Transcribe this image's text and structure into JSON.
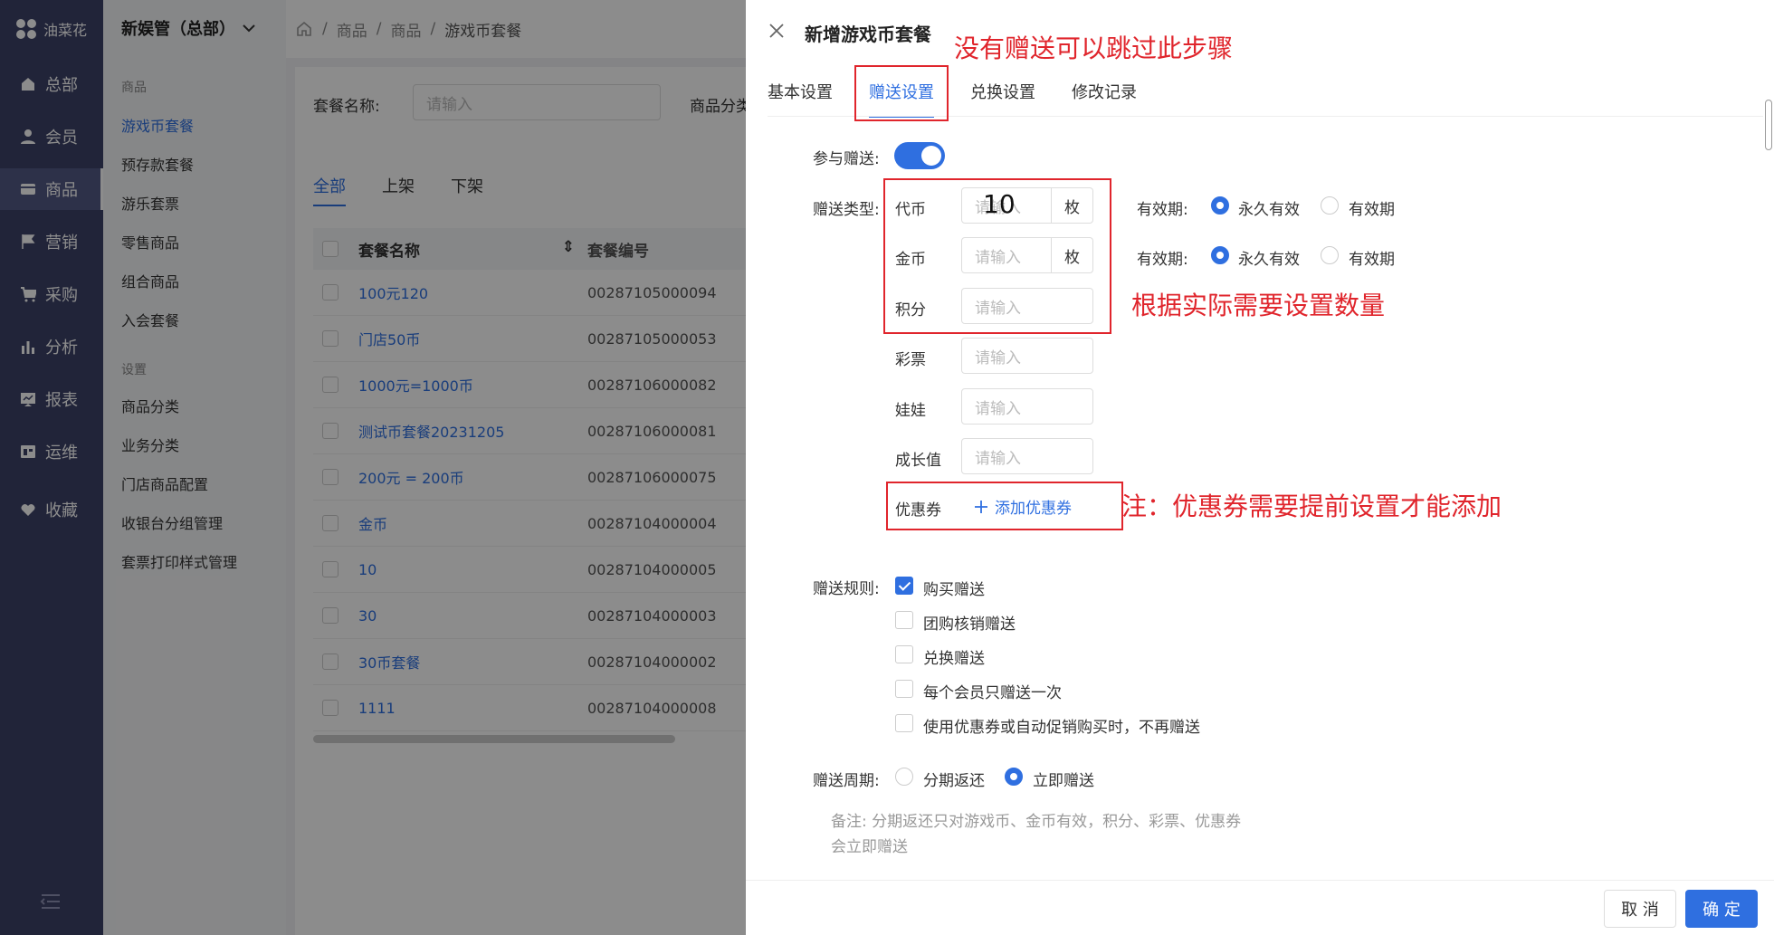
{
  "nav": {
    "brand": "油菜花",
    "items": [
      {
        "label": "总部",
        "icon": "home-icon"
      },
      {
        "label": "会员",
        "icon": "user-icon"
      },
      {
        "label": "商品",
        "icon": "card-icon"
      },
      {
        "label": "营销",
        "icon": "flag-icon"
      },
      {
        "label": "采购",
        "icon": "cart-icon"
      },
      {
        "label": "分析",
        "icon": "bar-chart-icon"
      },
      {
        "label": "报表",
        "icon": "report-icon"
      },
      {
        "label": "运维",
        "icon": "tools-icon"
      },
      {
        "label": "收藏",
        "icon": "heart-icon"
      }
    ],
    "active_index": 2
  },
  "submenu": {
    "title": "新娱管（总部）",
    "group1": "商品",
    "items1": [
      "游戏币套餐",
      "预存款套餐",
      "游乐套票",
      "零售商品",
      "组合商品",
      "入会套餐"
    ],
    "group2": "设置",
    "items2": [
      "商品分类",
      "业务分类",
      "门店商品配置",
      "收银台分组管理",
      "套票打印样式管理"
    ],
    "active_item": "游戏币套餐"
  },
  "breadcrumb": [
    "商品",
    "商品",
    "游戏币套餐"
  ],
  "filter": {
    "name_label": "套餐名称:",
    "name_placeholder": "请输入",
    "category_label": "商品分类"
  },
  "list_tabs": [
    "全部",
    "上架",
    "下架"
  ],
  "table": {
    "headers": [
      "套餐名称",
      "套餐编号"
    ],
    "rows": [
      [
        "100元120",
        "00287105000094"
      ],
      [
        "门店50币",
        "00287105000053"
      ],
      [
        "1000元=1000币",
        "00287106000082"
      ],
      [
        "测试币套餐20231205",
        "00287106000081"
      ],
      [
        "200元 = 200币",
        "00287106000075"
      ],
      [
        "金币",
        "00287104000004"
      ],
      [
        "10",
        "00287104000005"
      ],
      [
        "30",
        "00287104000003"
      ],
      [
        "30币套餐",
        "00287104000002"
      ],
      [
        "1111",
        "00287104000008"
      ]
    ]
  },
  "drawer": {
    "title": "新增游戏币套餐",
    "tabs": [
      "基本设置",
      "赠送设置",
      "兑换设置",
      "修改记录"
    ],
    "active_tab": "赠送设置",
    "participate_label": "参与赠送:",
    "participate_on": true,
    "type_label": "赠送类型:",
    "types": [
      {
        "name": "代币",
        "value": "10",
        "placeholder": "请输入",
        "unit": "枚"
      },
      {
        "name": "金币",
        "value": "",
        "placeholder": "请输入",
        "unit": "枚"
      },
      {
        "name": "积分",
        "value": "",
        "placeholder": "请输入",
        "unit": ""
      },
      {
        "name": "彩票",
        "value": "",
        "placeholder": "请输入",
        "unit": ""
      },
      {
        "name": "娃娃",
        "value": "",
        "placeholder": "请输入",
        "unit": ""
      },
      {
        "name": "成长值",
        "value": "",
        "placeholder": "请输入",
        "unit": ""
      }
    ],
    "validity_label": "有效期:",
    "validity_options": [
      "永久有效",
      "有效期"
    ],
    "coupon_label": "优惠券",
    "coupon_add": "添加优惠券",
    "rule_label": "赠送规则:",
    "rules": [
      {
        "label": "购买赠送",
        "checked": true
      },
      {
        "label": "团购核销赠送",
        "checked": false
      },
      {
        "label": "兑换赠送",
        "checked": false
      },
      {
        "label": "每个会员只赠送一次",
        "checked": false
      },
      {
        "label": "使用优惠券或自动促销购买时，不再赠送",
        "checked": false
      }
    ],
    "period_label": "赠送周期:",
    "period_options": [
      "分期返还",
      "立即赠送"
    ],
    "period_selected": "立即赠送",
    "note": "备注: 分期返还只对游戏币、金币有效，积分、彩票、优惠券会立即赠送",
    "cancel": "取 消",
    "confirm": "确 定"
  },
  "annotations": {
    "skip": "没有赠送可以跳过此步骤",
    "quantity": "根据实际需要设置数量",
    "coupon_note": "注：优惠券需要提前设置才能添加"
  },
  "colors": {
    "accent": "#2f6fe0",
    "nav_bg": "#3d4269",
    "annotation": "#e0252c"
  }
}
